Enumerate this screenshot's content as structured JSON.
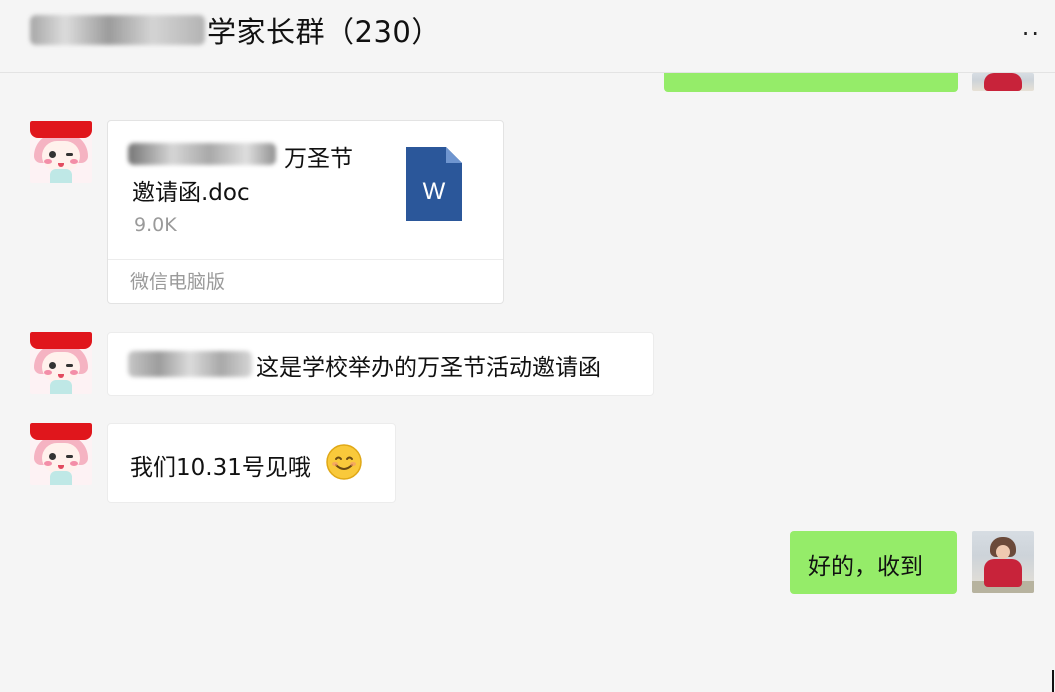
{
  "header": {
    "title": "学家长群（230）",
    "more_icon": "more-icon"
  },
  "messages": {
    "file": {
      "name_line1": "万圣节",
      "name_line2": "邀请函.doc",
      "size": "9.0K",
      "source": "微信电脑版",
      "icon": "word-doc-icon",
      "icon_letter": "W"
    },
    "text1": "这是学校举办的万圣节活动邀请函",
    "text2": "我们10.31号见哦",
    "text2_emoji": "smile-emoji",
    "reply": "好的，收到"
  },
  "colors": {
    "self_bubble": "#95ec69",
    "other_bubble": "#ffffff",
    "word_blue": "#2b579a",
    "background": "#f5f5f5"
  }
}
